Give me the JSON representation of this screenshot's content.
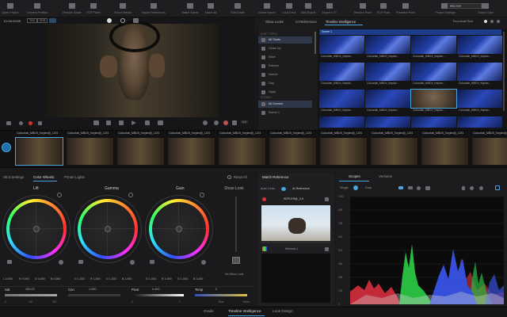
{
  "toolbar": {
    "left_items": [
      "Open Project",
      "Camera Profiles",
      "Remote Grade",
      "FCP Patch",
      "Export Media",
      "Import References",
      "Match Scene",
      "Match All",
      "Edit Grade",
      "Movie Export",
      "Look Deck",
      "3DB Export",
      "Export LUT",
      "Resolve Push",
      "FCP Push",
      "Premiere Push"
    ],
    "project_settings": "Project Settings",
    "output_color": "Output Color",
    "colorspace_value": "REC709"
  },
  "viewer": {
    "timecode": "01:00:03:09",
    "badge1": "TSS",
    "badge2": "SDR",
    "zoom": "0.0"
  },
  "shots": {
    "tabs": [
      "Show Looks",
      "AI References",
      "Timeline Intelligence"
    ],
    "shot_types_header": "SHOT TYPES",
    "shot_types": [
      "All Shots",
      "Close Up",
      "Wide",
      "Exterior",
      "Interior",
      "Day",
      "Night"
    ],
    "scenes_header": "SCENES",
    "scenes": [
      "All Scenes",
      "Scene 1"
    ],
    "thumbnail_size": "Thumbnail Size",
    "grid_header": "Scene 1"
  },
  "thumbs": [
    "Colourlab_MBOX_Keplan...",
    "Colourlab_MBOX_Keplan...",
    "Colourlab_MBOX_Keplan...",
    "Colourlab_MBOX_Keplan...",
    "Colourlab_MBOX_Keplan...",
    "Colourlab_MBOX_Keplan...",
    "Colourlab_MBOX_Keplan...",
    "Colourlab_MBOX_Keplan..."
  ],
  "timeline": {
    "clips": [
      "Colourlab_MBOX_Kepler@_LOG",
      "Colourlab_MBOX_Kepler@_LOG",
      "Colourlab_MBOX_Kepler@_LOG",
      "Colourlab_MBOX_Kepler@_LOG",
      "Colourlab_MBOX_Kepler@_LOG",
      "Colourlab_MBOX_Kepler@_LOG",
      "Colourlab_MBOX_Kepler@_LOG",
      "Colourlab_MBOX_Kepler@_LOG",
      "Colourlab_MBOX_Kepler@_LOG",
      "Colourlab_MBOX_Kepler@_LOG"
    ]
  },
  "grade": {
    "tabs": [
      "Shot Settings",
      "Color Wheels",
      "Printer Lights"
    ],
    "reset_all": "Reset All",
    "show_look": "Show Look",
    "no_show_look": "No Show Look",
    "wheels": [
      {
        "name": "Lift",
        "values": [
          "L 0.000",
          "R 0.000",
          "G 0.000",
          "B 0.000"
        ]
      },
      {
        "name": "Gamma",
        "values": [
          "G 1.000",
          "R 1.000",
          "G 1.000",
          "B 1.000"
        ]
      },
      {
        "name": "Gain",
        "values": [
          "G 1.000",
          "R 1.000",
          "G 1.000",
          "B 1.000"
        ]
      }
    ],
    "sliders": [
      {
        "label": "Sat",
        "value": "100.00",
        "ticks": [
          "0",
          "100",
          "200"
        ]
      },
      {
        "label": "Con",
        "value": "1.000",
        "ticks": [
          "",
          "",
          ""
        ]
      },
      {
        "label": "Pivot",
        "value": "0.400",
        "ticks": [
          "0",
          "",
          "1"
        ]
      },
      {
        "label": "Temp",
        "value": "0",
        "ticks": [
          "",
          "Blue",
          "Yellow"
        ]
      }
    ]
  },
  "match": {
    "header": "Match Reference",
    "auto_color": "Auto Color",
    "ai_reference": "AI Reference",
    "ref_name": "KEPLER@_9.5",
    "ref2_name": "Metrosa 1"
  },
  "scopes": {
    "tabs": [
      "Scopes",
      "Versions"
    ],
    "mode_single": "Single",
    "mode_dual": "Dual",
    "y_ticks": [
      "1023",
      "896",
      "768",
      "640",
      "512",
      "384",
      "256",
      "128",
      "0"
    ]
  },
  "bottom_tabs": [
    "Grade",
    "Timeline Intelligence",
    "Look Design"
  ]
}
